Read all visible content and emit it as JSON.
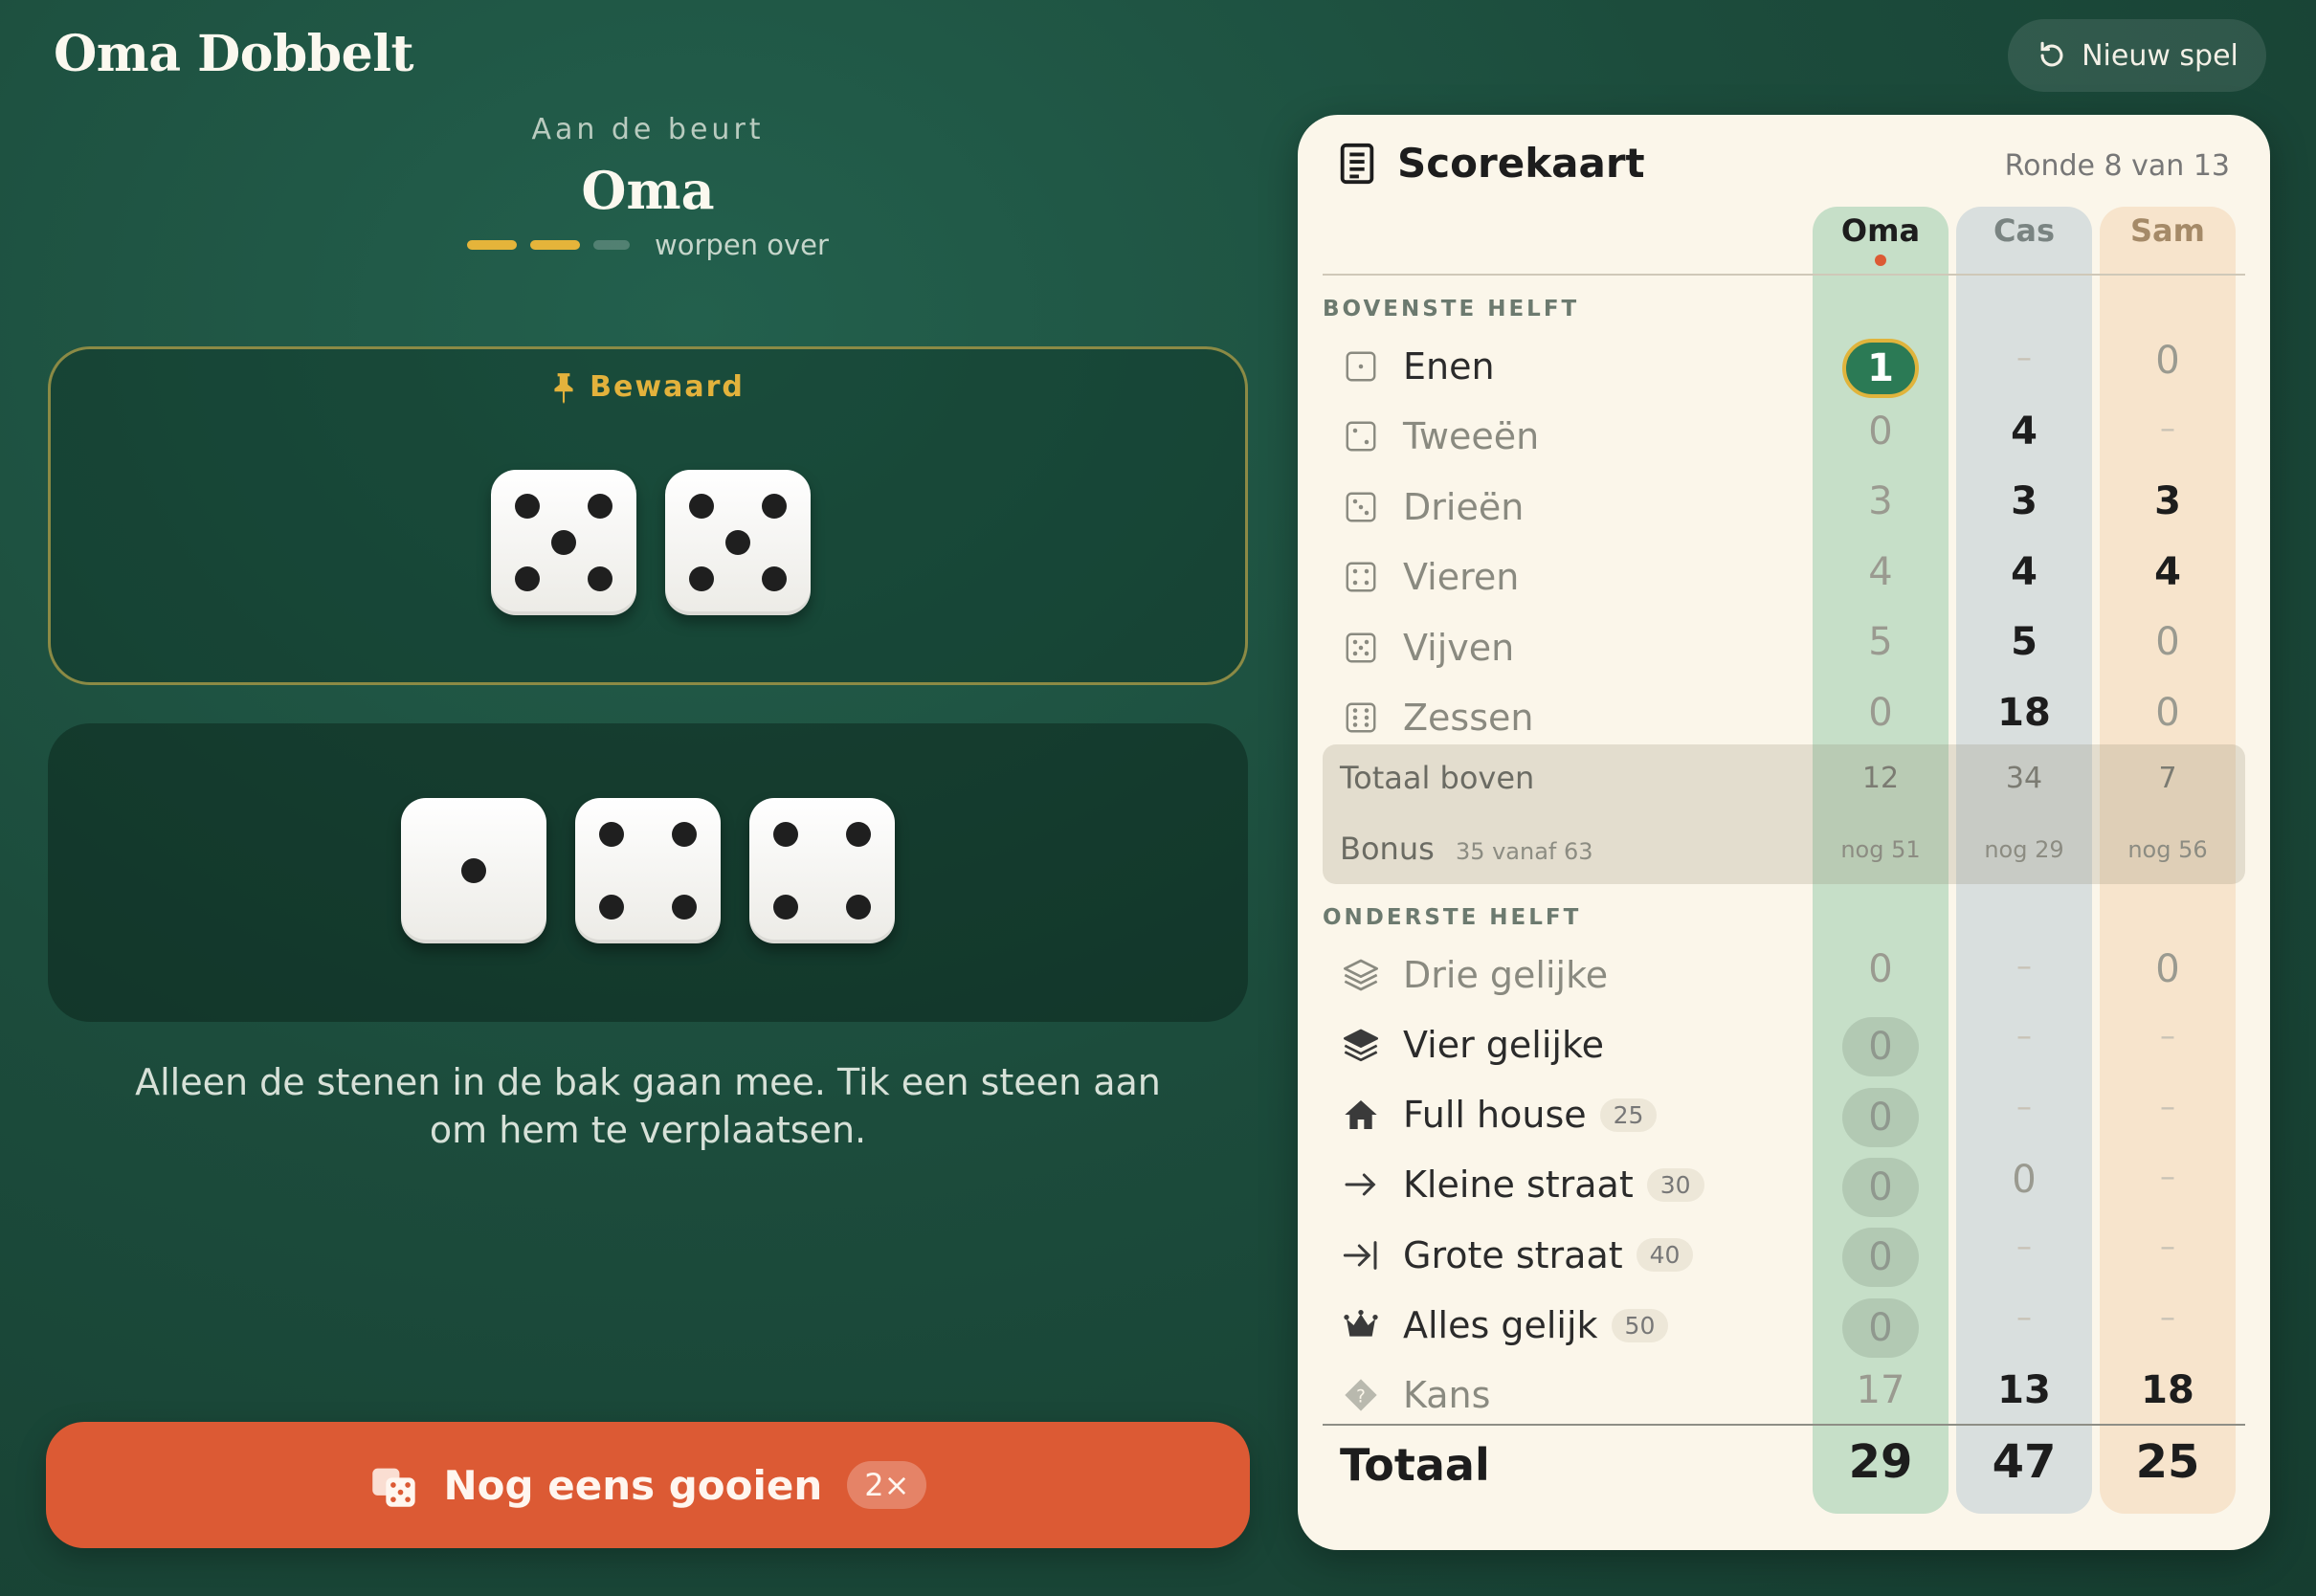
{
  "header": {
    "title": "Oma Dobbelt",
    "new_game_label": "Nieuw spel"
  },
  "turn": {
    "label": "Aan de beurt",
    "player": "Oma",
    "throws_left_text": "worpen over",
    "throws_used": 2,
    "throws_total": 3
  },
  "held": {
    "label": "Bewaard",
    "dice": [
      5,
      5
    ]
  },
  "tray": {
    "dice": [
      1,
      4,
      4
    ]
  },
  "hint": "Alleen de stenen in de bak gaan mee. Tik een steen aan om hem te verplaatsen.",
  "roll": {
    "label": "Nog eens gooien",
    "badge": "2×"
  },
  "scorecard": {
    "title": "Scorekaart",
    "round": "Ronde 8 van 13",
    "players": [
      "Oma",
      "Cas",
      "Sam"
    ],
    "upper_title": "BOVENSTE HELFT",
    "lower_title": "ONDERSTE HELFT",
    "upper": [
      {
        "name": "Enen",
        "icon": "die-one-icon",
        "scores": [
          "1",
          "–",
          "0"
        ]
      },
      {
        "name": "Tweeën",
        "icon": "die-two-icon",
        "scores": [
          "0",
          "4",
          "–"
        ]
      },
      {
        "name": "Drieën",
        "icon": "die-three-icon",
        "scores": [
          "3",
          "3",
          "3"
        ]
      },
      {
        "name": "Vieren",
        "icon": "die-four-icon",
        "scores": [
          "4",
          "4",
          "4"
        ]
      },
      {
        "name": "Vijven",
        "icon": "die-five-icon",
        "scores": [
          "5",
          "5",
          "0"
        ]
      },
      {
        "name": "Zessen",
        "icon": "die-six-icon",
        "scores": [
          "0",
          "18",
          "0"
        ]
      }
    ],
    "upper_total": {
      "label": "Totaal boven",
      "values": [
        "12",
        "34",
        "7"
      ]
    },
    "bonus": {
      "label": "Bonus",
      "note": "35 vanaf 63",
      "values": [
        "nog 51",
        "nog 29",
        "nog 56"
      ]
    },
    "lower": [
      {
        "name": "Drie gelijke",
        "icon": "layers-outline-icon",
        "badge": "",
        "scores": [
          "0",
          "–",
          "0"
        ]
      },
      {
        "name": "Vier gelijke",
        "icon": "layers-filled-icon",
        "badge": "",
        "scores": [
          "0",
          "–",
          "–"
        ]
      },
      {
        "name": "Full house",
        "icon": "house-icon",
        "badge": "25",
        "scores": [
          "0",
          "–",
          "–"
        ]
      },
      {
        "name": "Kleine straat",
        "icon": "arrow-right-icon",
        "badge": "30",
        "scores": [
          "0",
          "0",
          "–"
        ]
      },
      {
        "name": "Grote straat",
        "icon": "arrow-to-line-icon",
        "badge": "40",
        "scores": [
          "0",
          "–",
          "–"
        ]
      },
      {
        "name": "Alles gelijk",
        "icon": "crown-icon",
        "badge": "50",
        "scores": [
          "0",
          "–",
          "–"
        ]
      },
      {
        "name": "Kans",
        "icon": "question-diamond-icon",
        "badge": "",
        "scores": [
          "17",
          "13",
          "18"
        ]
      }
    ],
    "total": {
      "label": "Totaal",
      "values": [
        "29",
        "47",
        "25"
      ]
    }
  },
  "colors": {
    "accent": "#dc5a34",
    "gold": "#e3b23c",
    "felt": "#1c4c3c",
    "card": "#fbf6ea"
  }
}
